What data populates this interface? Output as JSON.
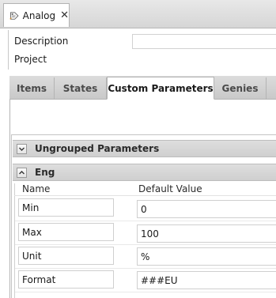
{
  "document_tab": {
    "title": "Analog",
    "icon": "tag-icon",
    "close_glyph": "✕"
  },
  "properties": {
    "description_label": "Description",
    "description_value": "",
    "project_label": "Project"
  },
  "tabs": [
    {
      "label": "Items",
      "active": false
    },
    {
      "label": "States",
      "active": false
    },
    {
      "label": "Custom Parameters",
      "active": true
    },
    {
      "label": "Genies",
      "active": false
    }
  ],
  "groups": {
    "ungrouped": {
      "title": "Ungrouped Parameters",
      "expanded": false
    },
    "eng": {
      "title": "Eng",
      "expanded": true
    }
  },
  "columns": {
    "name": "Name",
    "default_value": "Default Value"
  },
  "rows": [
    {
      "name": "Min",
      "value": "0"
    },
    {
      "name": "Max",
      "value": "100"
    },
    {
      "name": "Unit",
      "value": "%"
    },
    {
      "name": "Format",
      "value": "###EU"
    }
  ]
}
